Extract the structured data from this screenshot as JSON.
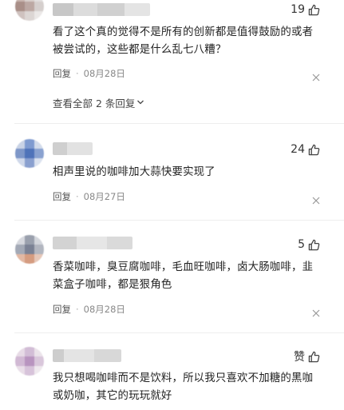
{
  "comments": [
    {
      "likes": "19",
      "text_lines": [
        "看了这个真的觉得不是所有的创新都是值得鼓励的或者",
        "被尝试的，这些都是什么乱七八糟？"
      ],
      "reply_label": "回复",
      "date": "08月28日",
      "view_all": "查看全部 2 条回复"
    },
    {
      "likes": "24",
      "text_lines": [
        "相声里说的咖啡加大蒜快要实现了"
      ],
      "reply_label": "回复",
      "date": "08月27日"
    },
    {
      "likes": "5",
      "text_lines": [
        "香菜咖啡，臭豆腐咖啡，毛血旺咖啡，卤大肠咖啡，韭",
        "菜盒子咖啡，都是狠角色"
      ],
      "reply_label": "回复",
      "date": "08月28日"
    },
    {
      "likes": "赞",
      "text_lines": [
        "我只想喝咖啡而不是饮料，所以我只喜欢不加糖的黑咖",
        "或奶咖，其它的玩玩就好"
      ]
    }
  ],
  "icons": {
    "like": "thumbs-up-icon",
    "close": "close-icon",
    "expand": "chevron-down-icon"
  },
  "colors": {
    "text": "#222222",
    "meta": "#888888",
    "icon": "#444444"
  }
}
